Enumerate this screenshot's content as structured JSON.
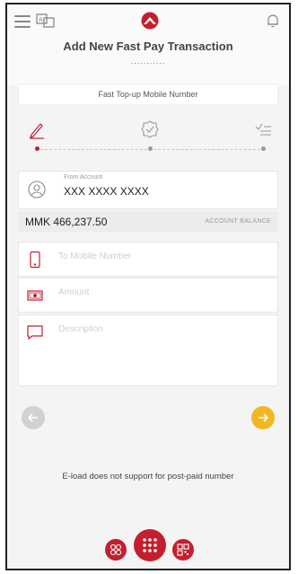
{
  "header": {
    "title": "Add New Fast Pay Transaction",
    "dots": "..........."
  },
  "section": {
    "label": "Fast Top-up Mobile Number"
  },
  "account": {
    "label": "From Account",
    "number": "XXX XXXX XXXX"
  },
  "balance": {
    "amount": "MMK 466,237.50",
    "label": "ACCOUNT BALANCE"
  },
  "fields": {
    "mobile_placeholder": "To Mobile Number",
    "amount_placeholder": "Amount",
    "description_placeholder": "Description"
  },
  "note": "E-load does not support for post-paid number",
  "colors": {
    "accent": "#c41f2f",
    "next": "#f2b824",
    "prev": "#d1d1d1"
  },
  "icons": [
    "menu-icon",
    "language-icon",
    "bank-logo",
    "bell-icon",
    "pencil-icon",
    "badge-check-icon",
    "list-check-icon",
    "user-icon",
    "phone-icon",
    "cash-icon",
    "message-icon",
    "arrow-left-icon",
    "arrow-right-icon",
    "dice-icon",
    "grid-icon",
    "qr-icon"
  ]
}
